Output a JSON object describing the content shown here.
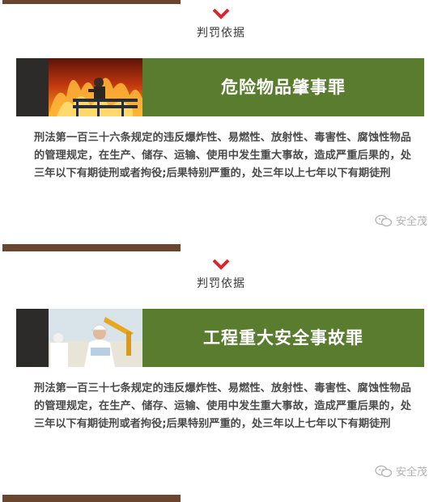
{
  "sections": [
    {
      "subtitle": "判罚依据",
      "heading": "危险物品肇事罪",
      "body": "刑法第一百三十六条规定的违反爆炸性、易燃性、放射性、毒害性、腐蚀性物品的管理规定，在生产、储存、运输、使用中发生重大事故，造成严重后果的，处三年以下有期徒刑或者拘役;后果特别严重的，处三年以上七年以下有期徒刑",
      "watermark": "安全茂"
    },
    {
      "subtitle": "判罚依据",
      "heading": "工程重大安全事故罪",
      "body": "刑法第一百三十七条规定的违反爆炸性、易燃性、放射性、毒害性、腐蚀性物品的管理规定，在生产、储存、运输、使用中发生重大事故，造成严重后果的，处三年以下有期徒刑或者拘役;后果特别严重的，处三年以上七年以下有期徒刑",
      "watermark": "安全茂"
    }
  ],
  "colors": {
    "banner_green": "#5a7c2e",
    "accent_red": "#d9252b",
    "divider_brown": "#6a4631"
  }
}
